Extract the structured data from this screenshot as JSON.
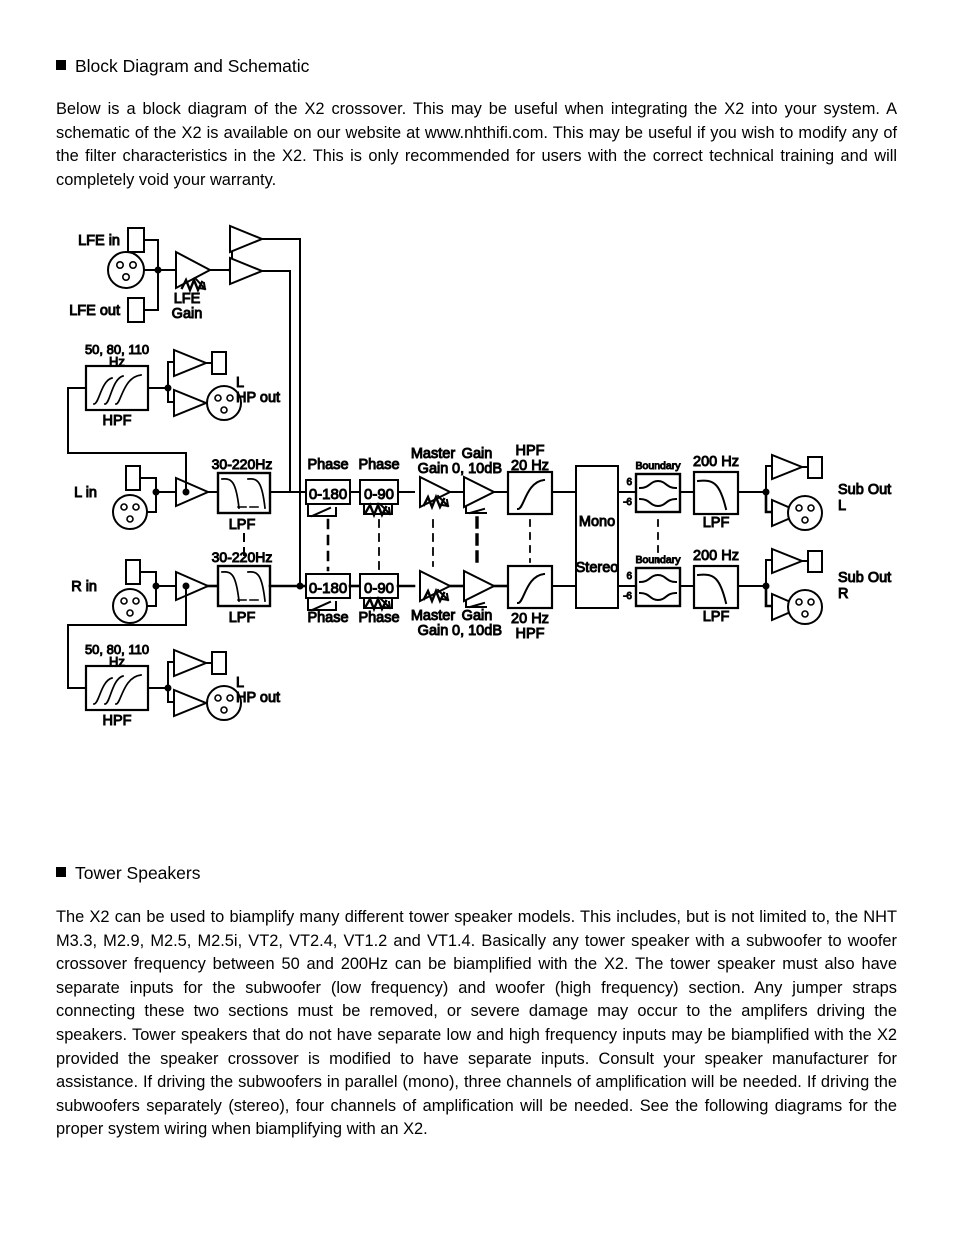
{
  "sections": [
    {
      "heading": "Block Diagram and Schematic",
      "body": "Below  is a block diagram of the X2 crossover. This may be useful when integrating the X2 into your system. A schematic of the X2 is available on our website at www.nhthifi.com. This may be useful if you wish to modify any of the filter characteristics in the X2. This is only recommended for users with the correct technical training and will completely void your warranty."
    },
    {
      "heading": "Tower Speakers",
      "body": "The X2 can be used to biamplify many different tower speaker models. This includes, but is not limited to, the NHT M3.3, M2.9, M2.5, M2.5i, VT2, VT2.4, VT1.2 and VT1.4. Basically any tower speaker with a subwoofer to woofer crossover frequency between 50 and 200Hz can be biamplified with the X2. The tower speaker must also have separate inputs for the subwoofer (low frequency) and woofer (high frequency) section. Any jumper straps connecting these two sections must be removed, or severe damage may occur to the amplifers driving the speakers. Tower speakers that do not have separate low and high frequency inputs may be biamplified with the X2 provided the speaker crossover is modified to have separate inputs. Consult your speaker manufacturer for assistance. If driving the subwoofers in parallel (mono), three channels of amplification will be needed. If driving the subwoofers separately (stereo), four channels of amplification will be needed. See the following diagrams for the proper system wiring when biamplifying with an X2."
    }
  ],
  "diagram": {
    "title": "X2 crossover block diagram",
    "labels": {
      "lfe_in": "LFE in",
      "lfe_out": "LFE out",
      "lfe_gain_line1": "LFE",
      "lfe_gain_line2": "Gain",
      "hpf_freqs_line1": "50, 80, 110",
      "hpf_freqs_line2": "Hz",
      "hpf": "HPF",
      "hp_out_top_line1": "L",
      "hp_out_top_line2": "HP out",
      "hp_out_bottom_line1": "L",
      "hp_out_bottom_line2": "HP out",
      "l_in": "L in",
      "r_in": "R in",
      "lpf_range": "30-220Hz",
      "lpf": "LPF",
      "phase": "Phase",
      "phase_0_180": "0-180",
      "phase_0_90": "0-90",
      "master_gain_line1": "Master",
      "master_gain_line2": "Gain",
      "gain_line1": "Gain",
      "gain_line2": "0, 10dB",
      "hpf_20_line1": "HPF",
      "hpf_20_line2": "20 Hz",
      "hpf_20_bottom_line1": "20 Hz",
      "hpf_20_bottom_line2": "HPF",
      "mono": "Mono",
      "stereo": "Stereo",
      "boundary": "Boundary",
      "boundary_plus": "6",
      "boundary_minus": "-6",
      "lpf_200": "200 Hz",
      "lpf_200_label": "LPF",
      "sub_out_l_line1": "Sub Out",
      "sub_out_l_line2": "L",
      "sub_out_r_line1": "Sub Out",
      "sub_out_r_line2": "R"
    },
    "colors": {
      "line": "#000000",
      "text": "#000000",
      "background": "#ffffff"
    }
  }
}
